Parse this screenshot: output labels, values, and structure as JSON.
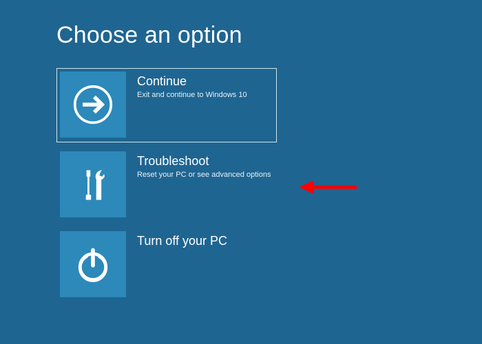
{
  "title": "Choose an option",
  "options": [
    {
      "label": "Continue",
      "desc": "Exit and continue to Windows 10"
    },
    {
      "label": "Troubleshoot",
      "desc": "Reset your PC or see advanced options"
    },
    {
      "label": "Turn off your PC",
      "desc": ""
    }
  ],
  "colors": {
    "background": "#1f6591",
    "tile": "#2c89ba",
    "annotation": "#ff0000"
  }
}
